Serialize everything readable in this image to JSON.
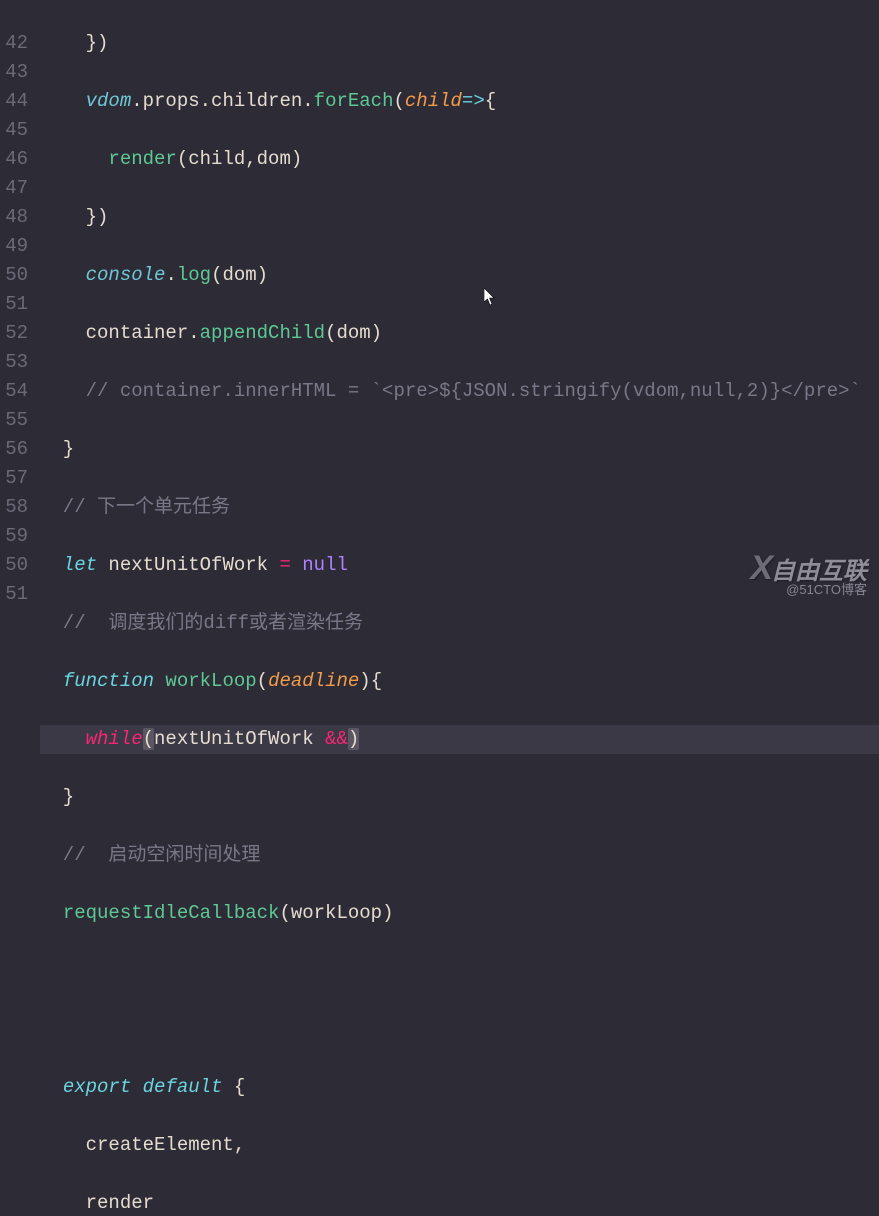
{
  "lineNumbers": [
    "",
    "42",
    "43",
    "44",
    "45",
    "46",
    "47",
    "48",
    "49",
    "50",
    "51",
    "52",
    "53",
    "54",
    "55",
    "56",
    "57",
    "58",
    "59",
    "50",
    "51"
  ],
  "code": {
    "l41_b": "    })",
    "l42_a": "    ",
    "l42_vdom": "vdom",
    "l42_dot1": ".",
    "l42_props": "props",
    "l42_dot2": ".",
    "l42_children": "children",
    "l42_dot3": ".",
    "l42_foreach": "forEach",
    "l42_op": "(",
    "l42_child": "child",
    "l42_arrow": "=>",
    "l42_cb": "{",
    "l43_a": "      ",
    "l43_render": "render",
    "l43_args": "(child,dom)",
    "l44": "    })",
    "l45_a": "    ",
    "l45_console": "console",
    "l45_dot": ".",
    "l45_log": "log",
    "l45_args": "(dom)",
    "l46_a": "    container.",
    "l46_append": "appendChild",
    "l46_args": "(dom)",
    "l47": "    // container.innerHTML = `<pre>${JSON.stringify(vdom,null,2)}</pre>`",
    "l48": "  }",
    "l49": "  // 下一个单元任务",
    "l50_a": "  ",
    "l50_let": "let",
    "l50_name": " nextUnitOfWork ",
    "l50_eq": "=",
    "l50_sp": " ",
    "l50_null": "null",
    "l51": "  //  调度我们的diff或者渲染任务",
    "l52_a": "  ",
    "l52_fn": "function",
    "l52_name": " workLoop",
    "l52_op": "(",
    "l52_param": "deadline",
    "l52_cp": ")",
    "l52_cb": "{",
    "l53_a": "    ",
    "l53_while": "while",
    "l53_op": "(",
    "l53_nuw": "nextUnitOfWork ",
    "l53_and": "&&",
    "l53_cp": ")",
    "l54": "  }",
    "l55": "  //  启动空闲时间处理",
    "l56_a": "  ",
    "l56_ric": "requestIdleCallback",
    "l56_args": "(workLoop)",
    "l59_a": "  ",
    "l59_export": "export",
    "l59_sp": " ",
    "l59_default": "default",
    "l59_cb": " {",
    "l60": "    createElement,",
    "l61": "    render"
  },
  "watermark": {
    "main": "自由互联",
    "sub": "@51CTO博客"
  }
}
